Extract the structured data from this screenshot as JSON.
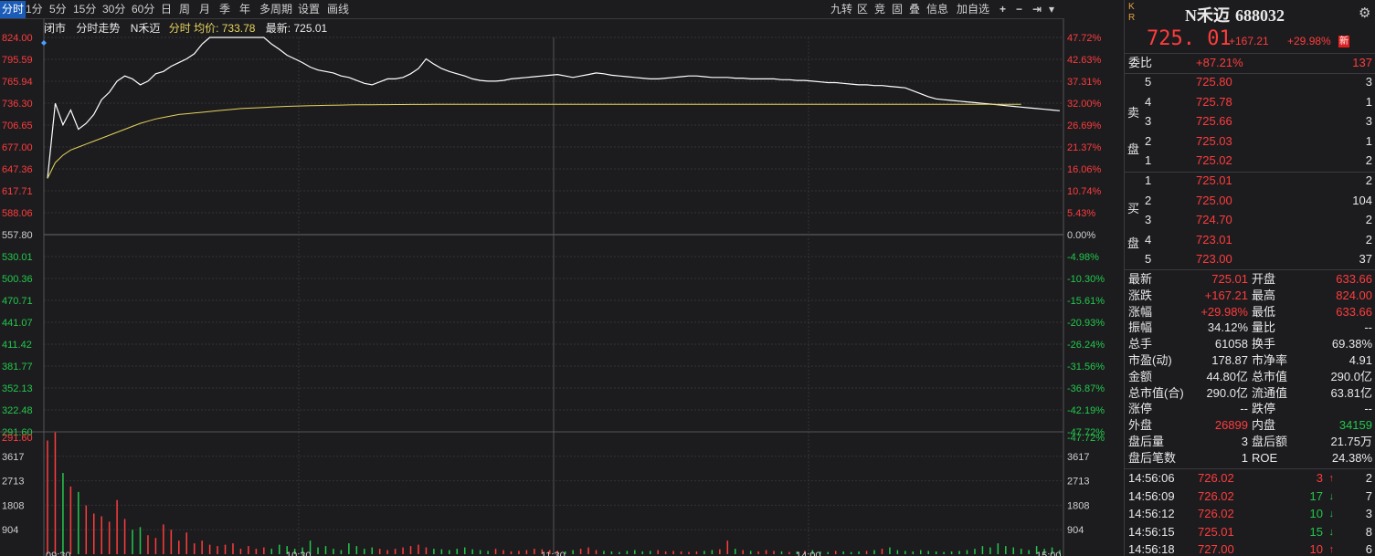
{
  "toolbar": {
    "items": [
      "分时",
      "1分",
      "5分",
      "15分",
      "30分",
      "60分",
      "日",
      "周",
      "月",
      "季",
      "年",
      "多周期",
      "设置",
      "画线"
    ],
    "right_items": [
      "九转",
      "区",
      "竞",
      "固",
      "叠",
      "信息",
      "加自选"
    ],
    "right_icons": [
      "plus-icon",
      "minus-icon",
      "jump-end-icon",
      "dropdown-icon"
    ]
  },
  "infoline": {
    "status": "闭市",
    "mode": "分时走势",
    "name": "N禾迈",
    "avg_label": "分时 均价:",
    "avg_value": "733.78",
    "latest_label": "最新:",
    "latest_value": "725.01"
  },
  "axis": {
    "price_labels": [
      "824.00",
      "795.59",
      "765.94",
      "736.30",
      "706.65",
      "677.00",
      "647.36",
      "617.71",
      "588.06",
      "557.80",
      "530.01",
      "500.36",
      "470.71",
      "441.07",
      "411.42",
      "381.77",
      "352.13",
      "322.48",
      "291.60"
    ],
    "pct_labels": [
      "47.72%",
      "42.63%",
      "37.31%",
      "32.00%",
      "26.69%",
      "21.37%",
      "16.06%",
      "10.74%",
      "5.43%",
      "0.00%",
      "-4.98%",
      "-10.30%",
      "-15.61%",
      "-20.93%",
      "-26.24%",
      "-31.56%",
      "-36.87%",
      "-42.19%",
      "-47.72%"
    ],
    "vol_labels": [
      "3617",
      "2713",
      "1808",
      "904"
    ],
    "time_labels": [
      "09:30",
      "10:30",
      "11:30",
      "14:00",
      "15:00"
    ]
  },
  "chart_data": {
    "type": "line",
    "title": "分时走势",
    "ylim": [
      291.6,
      824.0
    ],
    "prev_close": 557.8,
    "series": [
      {
        "name": "分时",
        "color": "#ffffff",
        "values": [
          633.66,
          735,
          706,
          726,
          700,
          708,
          720,
          740,
          750,
          765,
          772,
          768,
          760,
          765,
          775,
          778,
          785,
          790,
          795,
          802,
          815,
          824,
          824,
          824,
          824,
          824,
          824,
          824,
          824,
          815,
          808,
          800,
          795,
          790,
          784,
          780,
          778,
          776,
          772,
          770,
          766,
          762,
          760,
          764,
          768,
          768,
          770,
          775,
          782,
          795,
          788,
          782,
          778,
          775,
          772,
          768,
          766,
          765,
          765,
          766,
          768,
          769,
          770,
          771,
          772,
          773,
          774,
          772,
          770,
          772,
          774,
          776,
          775,
          773,
          772,
          771,
          770,
          769,
          768,
          768,
          769,
          770,
          771,
          772,
          772,
          771,
          770,
          770,
          770,
          769,
          769,
          768,
          768,
          768,
          768,
          767,
          767,
          766,
          766,
          765,
          764,
          763,
          763,
          762,
          761,
          760,
          760,
          759,
          759,
          758,
          757,
          756,
          752,
          748,
          744,
          741,
          740,
          739,
          738,
          737,
          736,
          735,
          734,
          733,
          732,
          731,
          730,
          729,
          728,
          727,
          726,
          725.01
        ]
      },
      {
        "name": "均价",
        "color": "#e6d35a",
        "values": [
          633.66,
          655,
          665,
          672,
          676,
          680,
          684,
          688,
          692,
          696,
          700,
          704,
          708,
          711,
          714,
          716,
          718,
          720,
          721,
          722,
          723,
          724,
          725,
          726,
          727,
          728,
          728.5,
          729,
          729.5,
          730,
          730.5,
          731,
          731.3,
          731.6,
          731.9,
          732.1,
          732.3,
          732.5,
          732.7,
          732.9,
          733.0,
          733.1,
          733.2,
          733.3,
          733.35,
          733.4,
          733.45,
          733.5,
          733.55,
          733.6,
          733.62,
          733.64,
          733.66,
          733.68,
          733.7,
          733.72,
          733.74,
          733.75,
          733.76,
          733.77,
          733.78,
          733.78,
          733.78,
          733.78,
          733.78,
          733.78,
          733.78,
          733.78,
          733.78,
          733.78,
          733.78,
          733.78,
          733.78,
          733.78,
          733.78,
          733.78,
          733.78,
          733.78,
          733.78,
          733.78,
          733.78,
          733.78,
          733.78,
          733.78,
          733.78,
          733.78,
          733.78,
          733.78,
          733.78,
          733.78,
          733.78,
          733.78,
          733.78,
          733.78,
          733.78,
          733.78,
          733.78,
          733.78,
          733.78,
          733.78,
          733.78,
          733.78,
          733.78,
          733.78,
          733.78,
          733.78,
          733.78,
          733.78,
          733.78,
          733.78,
          733.78,
          733.78,
          733.78,
          733.78,
          733.78,
          733.78,
          733.78,
          733.78,
          733.78,
          733.78,
          733.78,
          733.78,
          733.78,
          733.78,
          733.78,
          733.78,
          733.78
        ]
      }
    ],
    "volume": {
      "ylim": [
        0,
        4521
      ],
      "values": [
        4200,
        4500,
        3000,
        2500,
        2300,
        1800,
        1500,
        1400,
        1200,
        2000,
        1300,
        900,
        1000,
        700,
        600,
        1100,
        900,
        500,
        800,
        400,
        500,
        350,
        300,
        350,
        400,
        200,
        300,
        200,
        250,
        200,
        350,
        300,
        200,
        250,
        500,
        250,
        300,
        200,
        150,
        400,
        300,
        200,
        250,
        200,
        150,
        200,
        250,
        300,
        350,
        250,
        200,
        180,
        150,
        200,
        250,
        180,
        150,
        120,
        200,
        150,
        100,
        120,
        150,
        200,
        180,
        150,
        120,
        100,
        150,
        200,
        250,
        150,
        120,
        100,
        80,
        120,
        150,
        100,
        120,
        150,
        100,
        120,
        100,
        80,
        100,
        120,
        150,
        180,
        500,
        200,
        150,
        120,
        100,
        150,
        120,
        100,
        80,
        100,
        120,
        150,
        100,
        80,
        120,
        100,
        80,
        100,
        120,
        150,
        200,
        250,
        150,
        120,
        100,
        150,
        120,
        100,
        80,
        100,
        120,
        150,
        200,
        300,
        250,
        400,
        300,
        250,
        200,
        150,
        300,
        200,
        250,
        150
      ]
    }
  },
  "colors": {
    "up": "#ff3c3c",
    "down": "#22c84a",
    "price_line": "#ffffff",
    "avg_line": "#e6d35a",
    "grid": "#3a3a3e",
    "accent": "#1a5cb8"
  },
  "panel": {
    "kr": [
      "K",
      "R"
    ],
    "name": "N禾迈",
    "code": "688032",
    "price": "725. 01",
    "change": "+167.21",
    "pct": "+29.98%",
    "badge": "新",
    "weibi_label": "委比",
    "weibi_value": "+87.21%",
    "weibi_diff": "137",
    "sell_label": [
      "卖",
      "盘"
    ],
    "buy_label": [
      "买",
      "盘"
    ],
    "sells": [
      {
        "lvl": "5",
        "price": "725.80",
        "vol": "3"
      },
      {
        "lvl": "4",
        "price": "725.78",
        "vol": "1"
      },
      {
        "lvl": "3",
        "price": "725.66",
        "vol": "3"
      },
      {
        "lvl": "2",
        "price": "725.03",
        "vol": "1"
      },
      {
        "lvl": "1",
        "price": "725.02",
        "vol": "2"
      }
    ],
    "buys": [
      {
        "lvl": "1",
        "price": "725.01",
        "vol": "2"
      },
      {
        "lvl": "2",
        "price": "725.00",
        "vol": "104"
      },
      {
        "lvl": "3",
        "price": "724.70",
        "vol": "2"
      },
      {
        "lvl": "4",
        "price": "723.01",
        "vol": "2"
      },
      {
        "lvl": "5",
        "price": "723.00",
        "vol": "37"
      }
    ],
    "stats": [
      {
        "l1": "最新",
        "v1": "725.01",
        "c1": "red",
        "l2": "开盘",
        "v2": "633.66",
        "c2": "red"
      },
      {
        "l1": "涨跌",
        "v1": "+167.21",
        "c1": "red",
        "l2": "最高",
        "v2": "824.00",
        "c2": "red"
      },
      {
        "l1": "涨幅",
        "v1": "+29.98%",
        "c1": "red",
        "l2": "最低",
        "v2": "633.66",
        "c2": "red"
      },
      {
        "l1": "振幅",
        "v1": "34.12%",
        "c1": "white",
        "l2": "量比",
        "v2": "--",
        "c2": "white"
      },
      {
        "l1": "总手",
        "v1": "61058",
        "c1": "white",
        "l2": "换手",
        "v2": "69.38%",
        "c2": "white"
      },
      {
        "l1": "市盈(动)",
        "v1": "178.87",
        "c1": "white",
        "l2": "市净率",
        "v2": "4.91",
        "c2": "white"
      },
      {
        "l1": "金额",
        "v1": "44.80亿",
        "c1": "white",
        "l2": "总市值",
        "v2": "290.0亿",
        "c2": "white"
      },
      {
        "l1": "总市值(合)",
        "v1": "290.0亿",
        "c1": "white",
        "l2": "流通值",
        "v2": "63.81亿",
        "c2": "white"
      },
      {
        "l1": "涨停",
        "v1": "--",
        "c1": "white",
        "l2": "跌停",
        "v2": "--",
        "c2": "white"
      },
      {
        "l1": "外盘",
        "v1": "26899",
        "c1": "red",
        "l2": "内盘",
        "v2": "34159",
        "c2": "green"
      },
      {
        "l1": "盘后量",
        "v1": "3",
        "c1": "white",
        "l2": "盘后额",
        "v2": "21.75万",
        "c2": "white"
      },
      {
        "l1": "盘后笔数",
        "v1": "1",
        "c1": "white",
        "l2": "ROE",
        "v2": "24.38%",
        "c2": "white"
      }
    ],
    "ticks": [
      {
        "time": "14:56:06",
        "price": "726.02",
        "vol": "3",
        "dir": "up",
        "count": "2"
      },
      {
        "time": "14:56:09",
        "price": "726.02",
        "vol": "17",
        "dir": "down",
        "count": "7"
      },
      {
        "time": "14:56:12",
        "price": "726.02",
        "vol": "10",
        "dir": "down",
        "count": "3"
      },
      {
        "time": "14:56:15",
        "price": "725.01",
        "vol": "15",
        "dir": "down",
        "count": "8"
      },
      {
        "time": "14:56:18",
        "price": "727.00",
        "vol": "10",
        "dir": "up",
        "count": "6"
      }
    ]
  }
}
